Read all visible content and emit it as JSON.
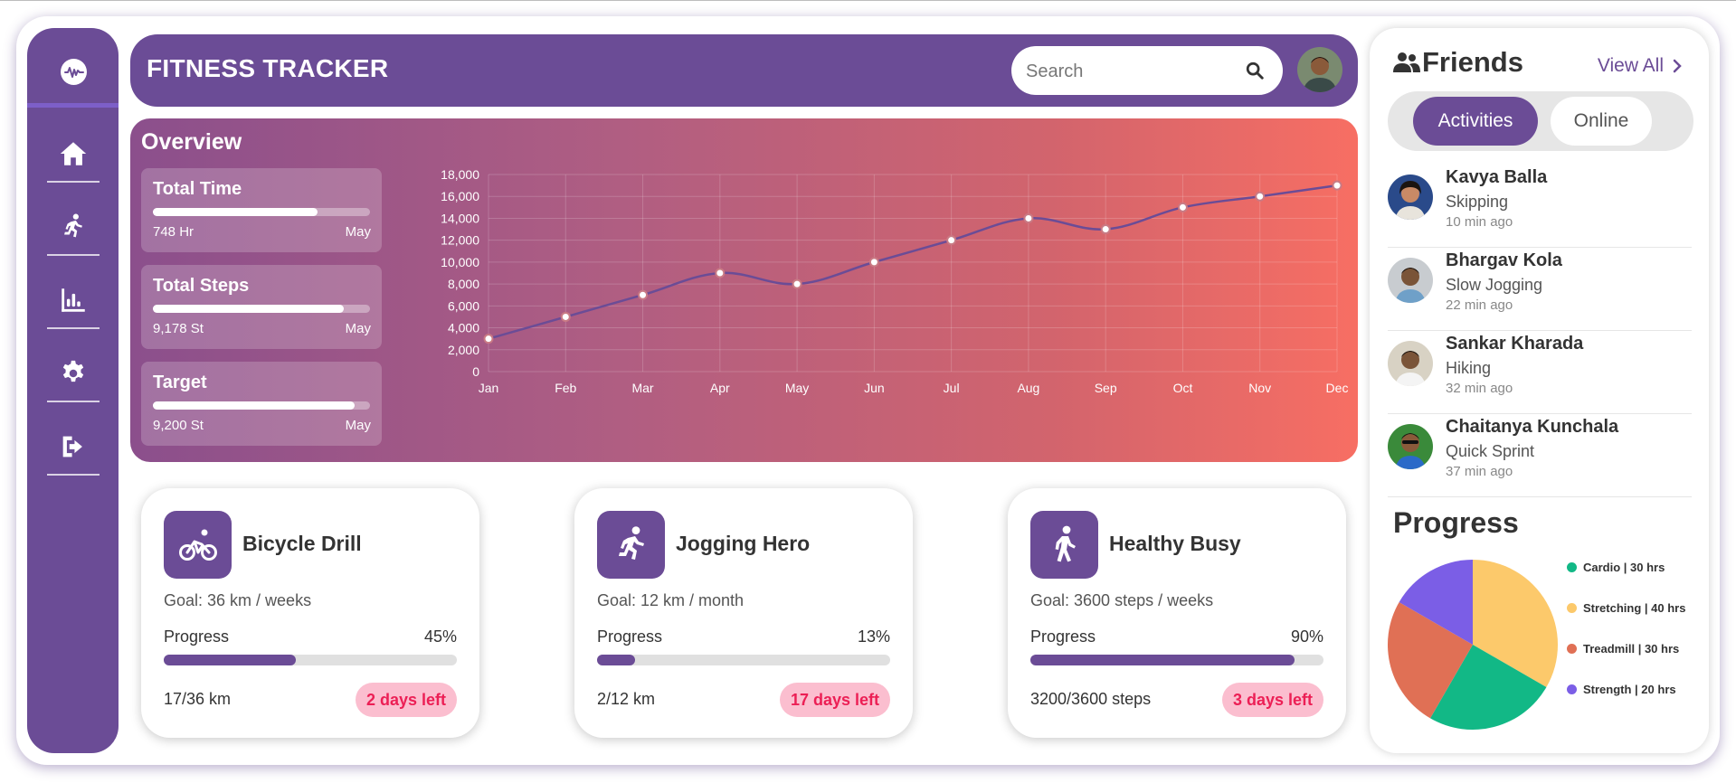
{
  "header": {
    "title": "FITNESS TRACKER",
    "search_placeholder": "Search"
  },
  "nav": {
    "items": [
      {
        "name": "home",
        "icon": "home-icon"
      },
      {
        "name": "activity",
        "icon": "running-icon"
      },
      {
        "name": "stats",
        "icon": "bar-chart-icon"
      },
      {
        "name": "settings",
        "icon": "gear-icon"
      },
      {
        "name": "logout",
        "icon": "logout-icon"
      }
    ]
  },
  "overview": {
    "title": "Overview",
    "stats": [
      {
        "title": "Total Time",
        "value": "748 Hr",
        "period": "May",
        "progress": 0.76
      },
      {
        "title": "Total Steps",
        "value": "9,178 St",
        "period": "May",
        "progress": 0.88
      },
      {
        "title": "Target",
        "value": "9,200 St",
        "period": "May",
        "progress": 0.93
      }
    ]
  },
  "chart_data": {
    "type": "line",
    "categories": [
      "Jan",
      "Feb",
      "Mar",
      "Apr",
      "May",
      "Jun",
      "Jul",
      "Aug",
      "Sep",
      "Oct",
      "Nov",
      "Dec"
    ],
    "values": [
      3000,
      5000,
      7000,
      9000,
      8000,
      10000,
      12000,
      14000,
      13000,
      15000,
      16000,
      17000
    ],
    "ylim": [
      0,
      18000
    ],
    "yticks": [
      "0",
      "2,000",
      "4,000",
      "6,000",
      "8,000",
      "10,000",
      "12,000",
      "14,000",
      "16,000",
      "18,000"
    ],
    "grid": true,
    "line_color": "#6b4c96"
  },
  "goals": [
    {
      "title": "Bicycle Drill",
      "icon": "bicycle-icon",
      "target": "Goal: 36 km / weeks",
      "progress_label": "Progress",
      "percent": "45%",
      "progress": 0.45,
      "done": "17/36 km",
      "badge": "2 days left"
    },
    {
      "title": "Jogging Hero",
      "icon": "running-icon",
      "target": "Goal: 12 km / month",
      "progress_label": "Progress",
      "percent": "13%",
      "progress": 0.13,
      "done": "2/12 km",
      "badge": "17 days left"
    },
    {
      "title": "Healthy Busy",
      "icon": "walking-icon",
      "target": "Goal: 3600 steps / weeks",
      "progress_label": "Progress",
      "percent": "90%",
      "progress": 0.9,
      "done": "3200/3600 steps",
      "badge": "3 days left"
    }
  ],
  "friends": {
    "title": "Friends",
    "view_all": "View All",
    "tabs": {
      "active": "Activities",
      "inactive": "Online"
    },
    "list": [
      {
        "name": "Kavya Balla",
        "activity": "Skipping",
        "time": "10 min ago"
      },
      {
        "name": "Bhargav Kola",
        "activity": "Slow Jogging",
        "time": "22 min ago"
      },
      {
        "name": "Sankar Kharada",
        "activity": "Hiking",
        "time": "32 min ago"
      },
      {
        "name": "Chaitanya Kunchala",
        "activity": "Quick Sprint",
        "time": "37 min ago"
      }
    ]
  },
  "progress": {
    "title": "Progress",
    "slices": [
      {
        "label": "Cardio | 30 hrs",
        "value": 30,
        "color": "#12b886"
      },
      {
        "label": "Stretching | 40 hrs",
        "value": 40,
        "color": "#fcc96b"
      },
      {
        "label": "Treadmill | 30 hrs",
        "value": 30,
        "color": "#e07055"
      },
      {
        "label": "Strength | 20 hrs",
        "value": 20,
        "color": "#7b5ee6"
      }
    ]
  },
  "colors": {
    "primary": "#6b4c96",
    "badge_bg": "#fbbecf",
    "badge_text": "#ec1f55"
  }
}
